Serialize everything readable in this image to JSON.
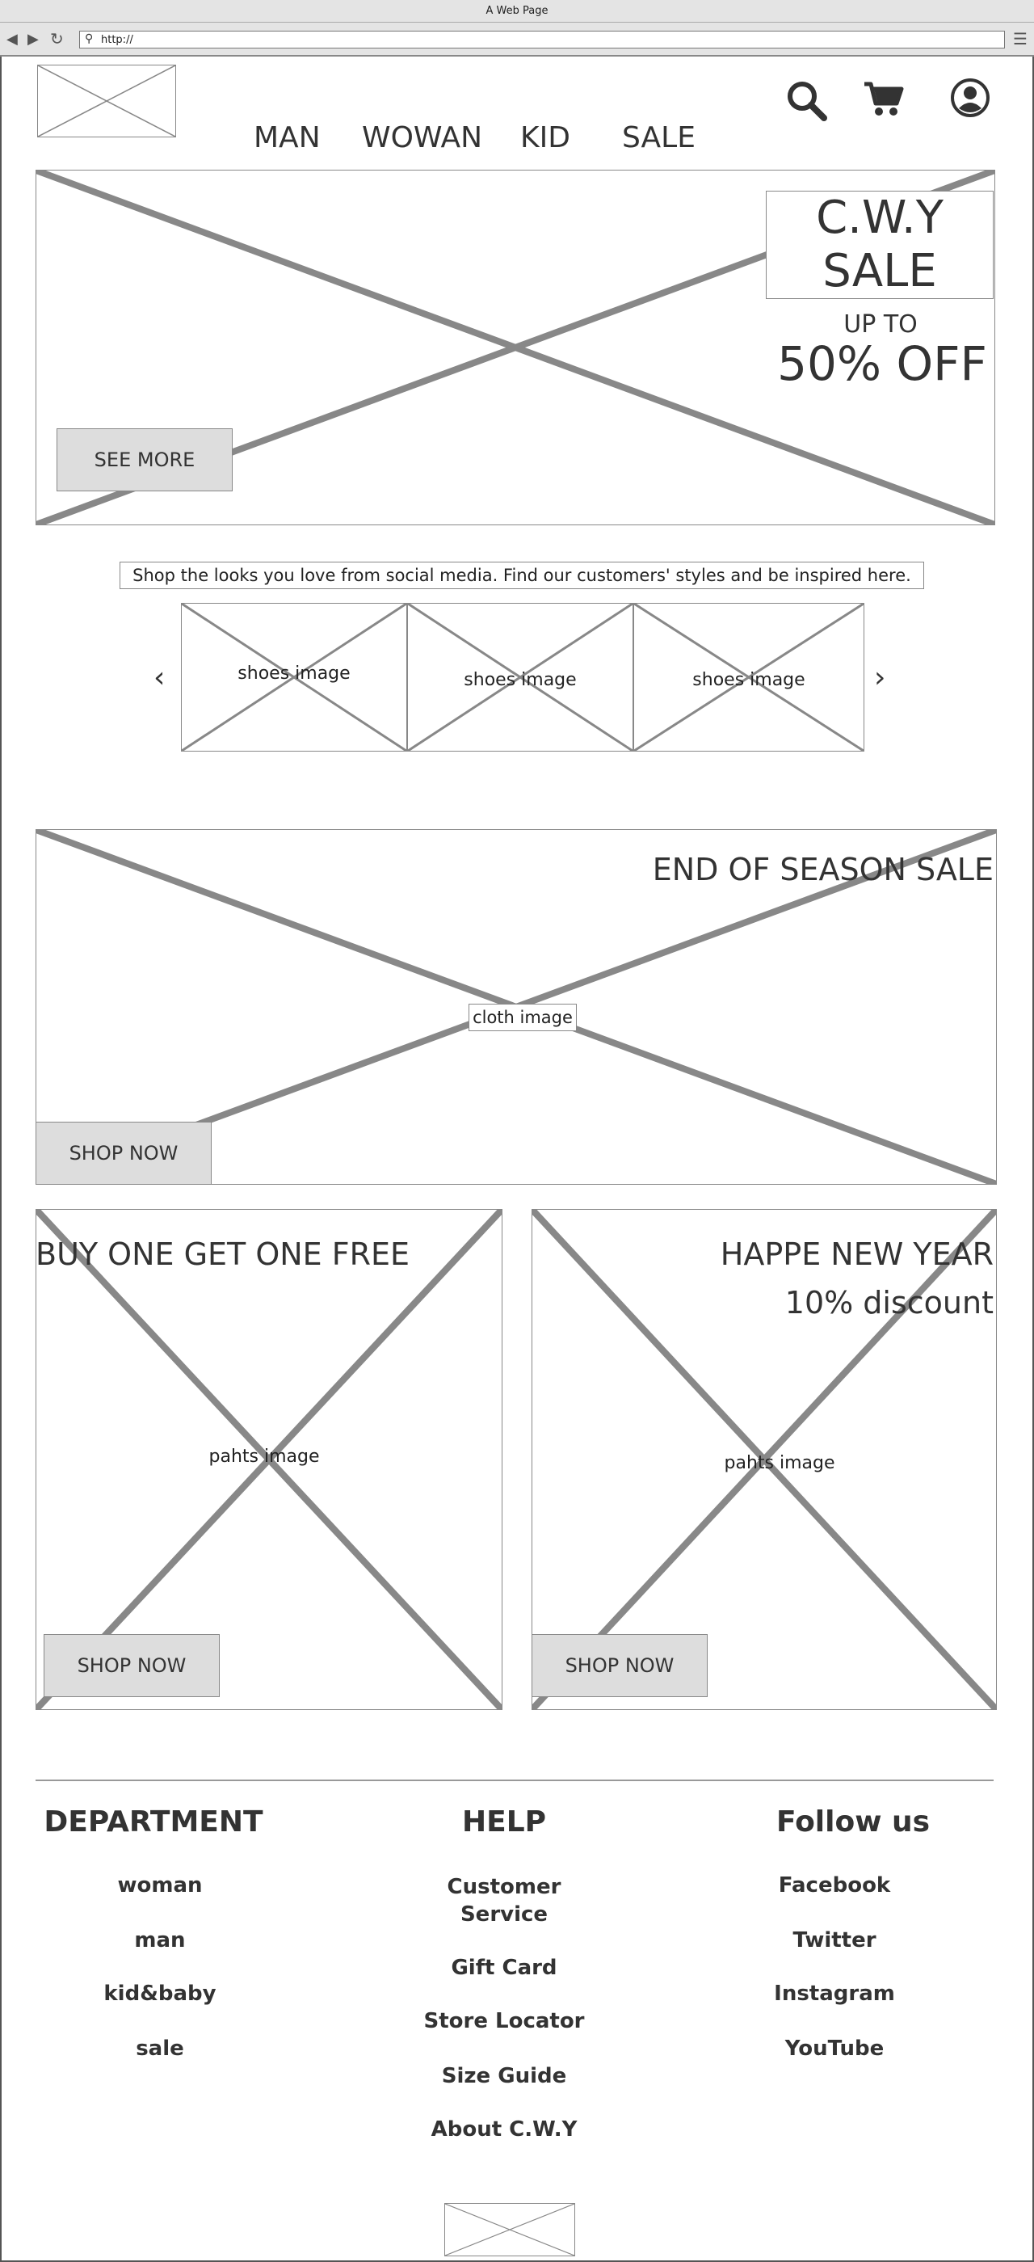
{
  "browser": {
    "title": "A Web Page",
    "url": "http://"
  },
  "nav": {
    "items": [
      "MAN",
      "WOWAN",
      "KID",
      "SALE"
    ]
  },
  "hero": {
    "title_line1": "C.W.Y",
    "title_line2": "SALE",
    "subtitle": "UP TO",
    "discount": "50% OFF",
    "button": "SEE MORE"
  },
  "social": {
    "caption": "Shop the looks you love from social media. Find our customers' styles and be inspired here.",
    "images": [
      "shoes image",
      "shoes image",
      "shoes image"
    ]
  },
  "season": {
    "title": "END OF SEASON SALE",
    "image_label": "cloth image",
    "button": "SHOP NOW"
  },
  "promo1": {
    "title": "BUY ONE GET ONE FREE",
    "image_label": "pahts image",
    "button": "SHOP NOW"
  },
  "promo2": {
    "title": "HAPPE NEW YEAR",
    "subtitle": "10% discount",
    "image_label": "pahts image",
    "button": "SHOP NOW"
  },
  "footer": {
    "department": {
      "heading": "DEPARTMENT",
      "links": [
        "woman",
        "man",
        "kid&baby",
        "sale"
      ]
    },
    "help": {
      "heading": "HELP",
      "links": [
        "Customer\nService",
        "Gift Card",
        "Store Locator",
        "Size Guide",
        "About C.W.Y"
      ]
    },
    "follow": {
      "heading": "Follow us",
      "links": [
        "Facebook",
        "Twitter",
        "Instagram",
        "YouTube"
      ]
    }
  }
}
